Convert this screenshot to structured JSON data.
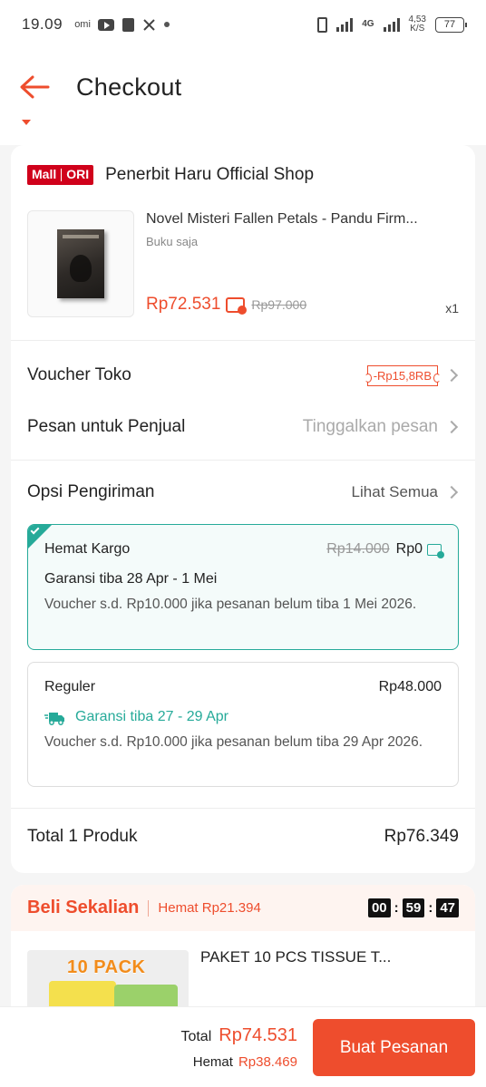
{
  "status_bar": {
    "time": "19.09",
    "icon_omi": "omi",
    "network": "4G",
    "speed": "4,53",
    "speed_unit": "K/S",
    "battery": "77"
  },
  "header": {
    "title": "Checkout"
  },
  "shop": {
    "badge_mall": "Mall",
    "badge_ori": "ORI",
    "name": "Penerbit Haru Official Shop"
  },
  "product": {
    "title": "Novel Misteri Fallen Petals - Pandu Firm...",
    "variant": "Buku saja",
    "price": "Rp72.531",
    "price_original": "Rp97.000",
    "qty": "x1"
  },
  "voucher": {
    "label": "Voucher Toko",
    "value": "-Rp15,8RB"
  },
  "message": {
    "label": "Pesan untuk Penjual",
    "placeholder": "Tinggalkan pesan"
  },
  "shipping": {
    "label": "Opsi Pengiriman",
    "see_all": "Lihat Semua",
    "options": [
      {
        "name": "Hemat Kargo",
        "price_old": "Rp14.000",
        "price": "Rp0",
        "eta": "Garansi tiba 28 Apr - 1 Mei",
        "note": "Voucher s.d. Rp10.000 jika pesanan belum tiba 1 Mei 2026.",
        "selected": true
      },
      {
        "name": "Reguler",
        "price": "Rp48.000",
        "eta": "Garansi tiba 27 - 29 Apr",
        "note": "Voucher s.d. Rp10.000 jika pesanan belum tiba 29 Apr 2026.",
        "selected": false
      }
    ]
  },
  "total": {
    "label": "Total 1 Produk",
    "value": "Rp76.349"
  },
  "promo": {
    "title": "Beli Sekalian",
    "save": "Hemat Rp21.394",
    "timer": [
      "00",
      "59",
      "47"
    ],
    "image_text": "10 PACK",
    "product": "PAKET 10 PCS TISSUE T..."
  },
  "bottom": {
    "total_label": "Total",
    "total_value": "Rp74.531",
    "save_label": "Hemat",
    "save_value": "Rp38.469",
    "order_button": "Buat Pesanan"
  },
  "colors": {
    "accent": "#ee4d2d",
    "teal": "#26aa99",
    "mall_red": "#d0011b"
  }
}
